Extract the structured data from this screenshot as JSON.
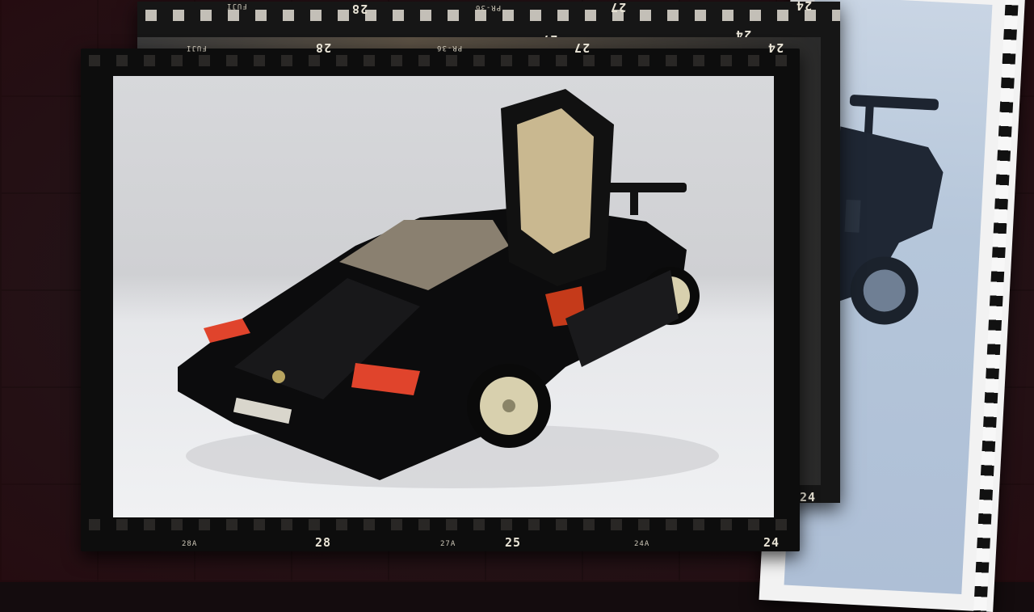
{
  "film_edge_markings": {
    "back_top_brand": "FUJI",
    "back_top_num_a": "28",
    "back_top_code": "PR-36",
    "back_top_num_b": "27",
    "back_top_num_c": "24",
    "mid_top_num_a": "27",
    "mid_top_num_b": "24",
    "main_top_brand": "FUJI",
    "main_top_num_a": "28",
    "main_top_code": "PR-36",
    "main_top_num_b": "27",
    "main_top_num_c": "24",
    "main_bottom_a": "28A",
    "main_bottom_b": "28",
    "main_bottom_c": "27A",
    "main_bottom_d": "25",
    "main_bottom_e": "24A",
    "main_bottom_f": "24",
    "mid_bottom_num": "24"
  },
  "colors": {
    "background": "#221519",
    "film_base": "#121212",
    "car_body": "#0b0b0c",
    "tail_light": "#e0442c",
    "wheel": "#d8d0ae"
  }
}
